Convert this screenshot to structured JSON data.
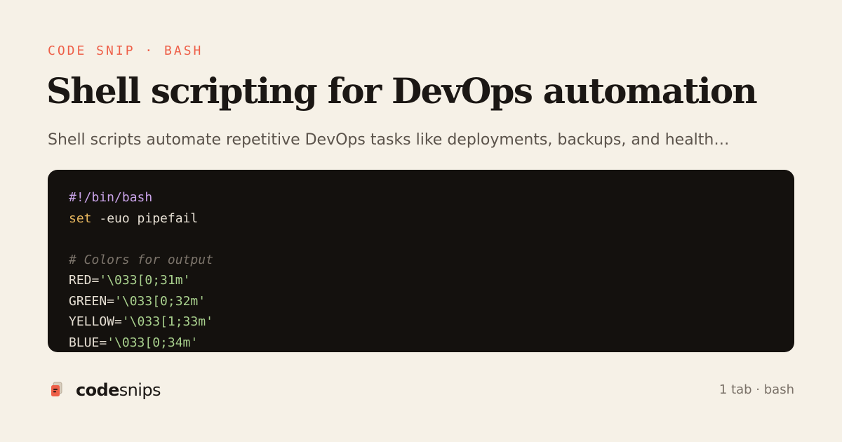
{
  "header": {
    "kicker": "CODE SNIP · BASH",
    "title": "Shell scripting for DevOps automation",
    "subtitle": "Shell scripts automate repetitive DevOps tasks like deployments, backups, and health…"
  },
  "code": {
    "language": "bash",
    "lines": [
      [
        {
          "text": "#!/bin/bash",
          "type": "shebang"
        }
      ],
      [
        {
          "text": "set",
          "type": "keyword"
        },
        {
          "text": " -euo pipefail",
          "type": "plain"
        }
      ],
      [],
      [
        {
          "text": "# Colors for output",
          "type": "comment"
        }
      ],
      [
        {
          "text": "RED=",
          "type": "plain"
        },
        {
          "text": "'\\033[0;31m'",
          "type": "string"
        }
      ],
      [
        {
          "text": "GREEN=",
          "type": "plain"
        },
        {
          "text": "'\\033[0;32m'",
          "type": "string"
        }
      ],
      [
        {
          "text": "YELLOW=",
          "type": "plain"
        },
        {
          "text": "'\\033[1;33m'",
          "type": "string"
        }
      ],
      [
        {
          "text": "BLUE=",
          "type": "plain"
        },
        {
          "text": "'\\033[0;34m'",
          "type": "string"
        }
      ]
    ]
  },
  "footer": {
    "brand_bold": "code",
    "brand_light": "snips",
    "icon": "snippet-cards-icon",
    "meta": "1 tab · bash"
  },
  "colors": {
    "background": "#f6f1e7",
    "accent": "#ee5f48",
    "code_background": "#14110e",
    "shebang": "#c9a3e8",
    "keyword": "#e9b85f",
    "string": "#a8d08d",
    "comment": "#7c746b"
  }
}
